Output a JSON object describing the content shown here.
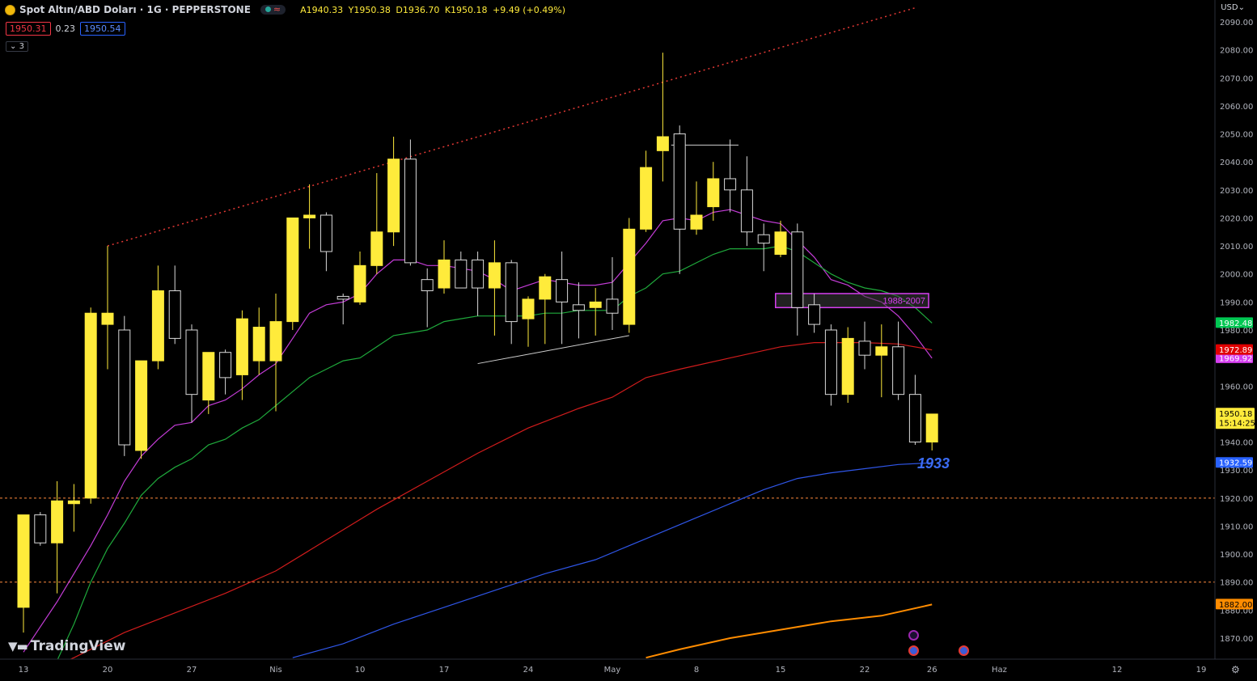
{
  "header": {
    "symbol_title": "Spot Altın/ABD Doları · 1G · PEPPERSTONE",
    "open": "A1940.33",
    "high": "Y1950.38",
    "low": "D1936.70",
    "close": "K1950.18",
    "change": "+9.49 (+0.49%)",
    "bid": "1950.31",
    "spread": "0.23",
    "ask": "1950.54",
    "collapse_label": "3"
  },
  "currency": "USD",
  "watermark": "TradingView",
  "colors": {
    "background": "#000000",
    "bull_candle": "#ffeb3b",
    "bear_candle": "#000000",
    "candle_outline": "#d9d9d9",
    "ema_magenta": "#c33cd6",
    "ema_green": "#1faa3c",
    "ema_red": "#d11c1c",
    "ema_blue": "#2f56e8",
    "ema_orange": "#ff8c00",
    "trendline": "#e53935",
    "hline": "#ff8a3d"
  },
  "icons": [
    "tradingview-logo-icon",
    "settings-gear-icon",
    "lightning-event-icon",
    "us-flag-event-icon"
  ],
  "chart_data": {
    "type": "candlestick",
    "y_axis": {
      "range": [
        1863,
        2094
      ],
      "ticks": [
        1870,
        1880,
        1890,
        1900,
        1910,
        1920,
        1930,
        1940,
        1950,
        1960,
        1970,
        1980,
        1990,
        2000,
        2010,
        2020,
        2030,
        2040,
        2050,
        2060,
        2070,
        2080,
        2090
      ],
      "tick_labels": [
        "1870.00",
        "1880.00",
        "1890.00",
        "1900.00",
        "1910.00",
        "1920.00",
        "1930.00",
        "1940.00",
        "1950.00",
        "1960.00",
        "1970.00",
        "1980.00",
        "1990.00",
        "2000.00",
        "2010.00",
        "2020.00",
        "2030.00",
        "2040.00",
        "2050.00",
        "2060.00",
        "2070.00",
        "2080.00",
        "2090.00"
      ]
    },
    "x_axis": {
      "tick_labels": [
        "13",
        "20",
        "27",
        "Nis",
        "10",
        "17",
        "24",
        "May",
        "8",
        "15",
        "22",
        "26",
        "Haz",
        "12",
        "19"
      ],
      "tick_bar_index": [
        0,
        5,
        10,
        15,
        20,
        25,
        30,
        35,
        40,
        45,
        50,
        54,
        58,
        65,
        70
      ]
    },
    "candles": [
      {
        "o": 1881,
        "h": 1914,
        "l": 1872,
        "c": 1914
      },
      {
        "o": 1914,
        "h": 1915,
        "l": 1903,
        "c": 1904
      },
      {
        "o": 1904,
        "h": 1926,
        "l": 1886,
        "c": 1919
      },
      {
        "o": 1918,
        "h": 1925,
        "l": 1908,
        "c": 1919
      },
      {
        "o": 1920,
        "h": 1988,
        "l": 1918,
        "c": 1986
      },
      {
        "o": 1982,
        "h": 2010,
        "l": 1966,
        "c": 1986
      },
      {
        "o": 1980,
        "h": 1985,
        "l": 1935,
        "c": 1939
      },
      {
        "o": 1937,
        "h": 1969,
        "l": 1934,
        "c": 1969
      },
      {
        "o": 1969,
        "h": 2003,
        "l": 1966,
        "c": 1994
      },
      {
        "o": 1994,
        "h": 2003,
        "l": 1975,
        "c": 1977
      },
      {
        "o": 1980,
        "h": 1982,
        "l": 1947,
        "c": 1957
      },
      {
        "o": 1955,
        "h": 1972,
        "l": 1950,
        "c": 1972
      },
      {
        "o": 1972,
        "h": 1973,
        "l": 1957,
        "c": 1963
      },
      {
        "o": 1964,
        "h": 1987,
        "l": 1955,
        "c": 1984
      },
      {
        "o": 1969,
        "h": 1988,
        "l": 1964,
        "c": 1981
      },
      {
        "o": 1969,
        "h": 1993,
        "l": 1951,
        "c": 1983
      },
      {
        "o": 1983,
        "h": 2020,
        "l": 1980,
        "c": 2020
      },
      {
        "o": 2020,
        "h": 2032,
        "l": 2009,
        "c": 2021
      },
      {
        "o": 2021,
        "h": 2022,
        "l": 2001,
        "c": 2008
      },
      {
        "o": 1992,
        "h": 1993,
        "l": 1982,
        "c": 1991
      },
      {
        "o": 1990,
        "h": 2008,
        "l": 1989,
        "c": 2003
      },
      {
        "o": 2003,
        "h": 2036,
        "l": 2000,
        "c": 2015
      },
      {
        "o": 2015,
        "h": 2049,
        "l": 2010,
        "c": 2041
      },
      {
        "o": 2041,
        "h": 2048,
        "l": 2003,
        "c": 2004
      },
      {
        "o": 1998,
        "h": 2002,
        "l": 1981,
        "c": 1994
      },
      {
        "o": 1995,
        "h": 2012,
        "l": 1993,
        "c": 2005
      },
      {
        "o": 2005,
        "h": 2008,
        "l": 1995,
        "c": 1995
      },
      {
        "o": 2005,
        "h": 2008,
        "l": 1985,
        "c": 1995
      },
      {
        "o": 1995,
        "h": 2012,
        "l": 1978,
        "c": 2004
      },
      {
        "o": 2004,
        "h": 2005,
        "l": 1975,
        "c": 1983
      },
      {
        "o": 1984,
        "h": 1992,
        "l": 1974,
        "c": 1991
      },
      {
        "o": 1991,
        "h": 2000,
        "l": 1975,
        "c": 1999
      },
      {
        "o": 1998,
        "h": 2008,
        "l": 1975,
        "c": 1990
      },
      {
        "o": 1989,
        "h": 1997,
        "l": 1977,
        "c": 1987
      },
      {
        "o": 1988,
        "h": 1995,
        "l": 1978,
        "c": 1990
      },
      {
        "o": 1991,
        "h": 2006,
        "l": 1980,
        "c": 1986
      },
      {
        "o": 1982,
        "h": 2020,
        "l": 1979,
        "c": 2016
      },
      {
        "o": 2016,
        "h": 2044,
        "l": 2015,
        "c": 2038
      },
      {
        "o": 2044,
        "h": 2079,
        "l": 2033,
        "c": 2049
      },
      {
        "o": 2050,
        "h": 2053,
        "l": 2000,
        "c": 2016
      },
      {
        "o": 2016,
        "h": 2033,
        "l": 2014,
        "c": 2021
      },
      {
        "o": 2024,
        "h": 2040,
        "l": 2019,
        "c": 2034
      },
      {
        "o": 2034,
        "h": 2048,
        "l": 2022,
        "c": 2030
      },
      {
        "o": 2030,
        "h": 2042,
        "l": 2010,
        "c": 2015
      },
      {
        "o": 2014,
        "h": 2018,
        "l": 2001,
        "c": 2011
      },
      {
        "o": 2007,
        "h": 2019,
        "l": 2006,
        "c": 2015
      },
      {
        "o": 2015,
        "h": 2018,
        "l": 1978,
        "c": 1988
      },
      {
        "o": 1989,
        "h": 1993,
        "l": 1979,
        "c": 1982
      },
      {
        "o": 1980,
        "h": 1982,
        "l": 1953,
        "c": 1957
      },
      {
        "o": 1957,
        "h": 1981,
        "l": 1954,
        "c": 1977
      },
      {
        "o": 1976,
        "h": 1983,
        "l": 1966,
        "c": 1971
      },
      {
        "o": 1971,
        "h": 1982,
        "l": 1956,
        "c": 1974
      },
      {
        "o": 1974,
        "h": 1983,
        "l": 1955,
        "c": 1957
      },
      {
        "o": 1957,
        "h": 1964,
        "l": 1939,
        "c": 1940
      },
      {
        "o": 1940,
        "h": 1950,
        "l": 1937,
        "c": 1950
      }
    ],
    "series": [
      {
        "values": [
          1865,
          1874,
          1883,
          1893,
          1903,
          1914,
          1926,
          1935,
          1941,
          1946,
          1947,
          1953,
          1955,
          1959,
          1964,
          1968,
          1977,
          1986,
          1989,
          1990,
          1993,
          2000,
          2005,
          2005,
          2003,
          2003,
          2002,
          2001,
          1998,
          1994,
          1996,
          1998,
          1997,
          1996,
          1996,
          1997,
          2004,
          2011,
          2019,
          2020,
          2019,
          2022,
          2023,
          2021,
          2019,
          2018,
          2012,
          2006,
          1998,
          1996,
          1992,
          1990,
          1985,
          1978,
          1969.92
        ]
      },
      {
        "values": null,
        "samples": [
          [
            2,
            1862
          ],
          [
            3,
            1875
          ],
          [
            4,
            1890
          ],
          [
            5,
            1902
          ],
          [
            6,
            1911
          ],
          [
            7,
            1921
          ],
          [
            8,
            1927
          ],
          [
            9,
            1931
          ],
          [
            10,
            1934
          ],
          [
            11,
            1939
          ],
          [
            12,
            1941
          ],
          [
            13,
            1945
          ],
          [
            14,
            1948
          ],
          [
            15,
            1953
          ],
          [
            16,
            1958
          ],
          [
            17,
            1963
          ],
          [
            18,
            1966
          ],
          [
            19,
            1969
          ],
          [
            20,
            1970
          ],
          [
            21,
            1974
          ],
          [
            22,
            1978
          ],
          [
            23,
            1979
          ],
          [
            24,
            1980
          ],
          [
            25,
            1983
          ],
          [
            26,
            1984
          ],
          [
            27,
            1985
          ],
          [
            28,
            1985
          ],
          [
            29,
            1985
          ],
          [
            30,
            1985
          ],
          [
            31,
            1986
          ],
          [
            32,
            1986
          ],
          [
            33,
            1987
          ],
          [
            34,
            1987
          ],
          [
            35,
            1987
          ],
          [
            36,
            1992
          ],
          [
            37,
            1995
          ],
          [
            38,
            2000
          ],
          [
            39,
            2001
          ],
          [
            40,
            2004
          ],
          [
            41,
            2007
          ],
          [
            42,
            2009
          ],
          [
            43,
            2009
          ],
          [
            44,
            2009
          ],
          [
            45,
            2010
          ],
          [
            46,
            2008
          ],
          [
            47,
            2004
          ],
          [
            48,
            2000
          ],
          [
            49,
            1997
          ],
          [
            50,
            1995
          ],
          [
            51,
            1994
          ],
          [
            52,
            1992
          ],
          [
            53,
            1988
          ],
          [
            54,
            1982.48
          ]
        ]
      },
      {
        "samples": [
          [
            0,
            1855
          ],
          [
            3,
            1863
          ],
          [
            6,
            1872
          ],
          [
            9,
            1879
          ],
          [
            12,
            1886
          ],
          [
            15,
            1894
          ],
          [
            18,
            1905
          ],
          [
            21,
            1916
          ],
          [
            24,
            1926
          ],
          [
            27,
            1936
          ],
          [
            30,
            1945
          ],
          [
            33,
            1952
          ],
          [
            35,
            1956
          ],
          [
            37,
            1963
          ],
          [
            39,
            1966
          ],
          [
            42,
            1970
          ],
          [
            45,
            1974
          ],
          [
            47,
            1975.5
          ],
          [
            50,
            1975.5
          ],
          [
            52,
            1975
          ],
          [
            54,
            1972.89
          ]
        ]
      },
      {
        "samples": [
          [
            16,
            1863
          ],
          [
            19,
            1868
          ],
          [
            22,
            1875
          ],
          [
            25,
            1881
          ],
          [
            28,
            1887
          ],
          [
            31,
            1893
          ],
          [
            34,
            1898
          ],
          [
            36,
            1903
          ],
          [
            38,
            1908
          ],
          [
            40,
            1913
          ],
          [
            42,
            1918
          ],
          [
            44,
            1923
          ],
          [
            46,
            1927
          ],
          [
            48,
            1929
          ],
          [
            50,
            1930.5
          ],
          [
            52,
            1932
          ],
          [
            54,
            1932.59
          ]
        ]
      },
      {
        "samples": [
          [
            37,
            1863
          ],
          [
            39,
            1866
          ],
          [
            42,
            1870
          ],
          [
            45,
            1873
          ],
          [
            48,
            1876
          ],
          [
            51,
            1878
          ],
          [
            54,
            1882.0
          ]
        ]
      }
    ],
    "series_last_labels": [
      "1969.92",
      "1982.48",
      "1972.89",
      "1932.59",
      "1882.00"
    ],
    "last_price_label": "1950.18",
    "countdown": "15:14:25",
    "annotations": {
      "zone_label": "1988-2007",
      "zone_range": [
        1988,
        1993
      ],
      "target_text": "1933",
      "hlines": [
        1920,
        1890
      ],
      "resistance_price": 2046,
      "trend_start": {
        "bar": 5,
        "price": 2010
      },
      "trend_end": {
        "bar": 53,
        "price": 2095
      },
      "support_start": {
        "bar": 27,
        "price": 1968
      },
      "support_end": {
        "bar": 36,
        "price": 1978
      }
    }
  }
}
